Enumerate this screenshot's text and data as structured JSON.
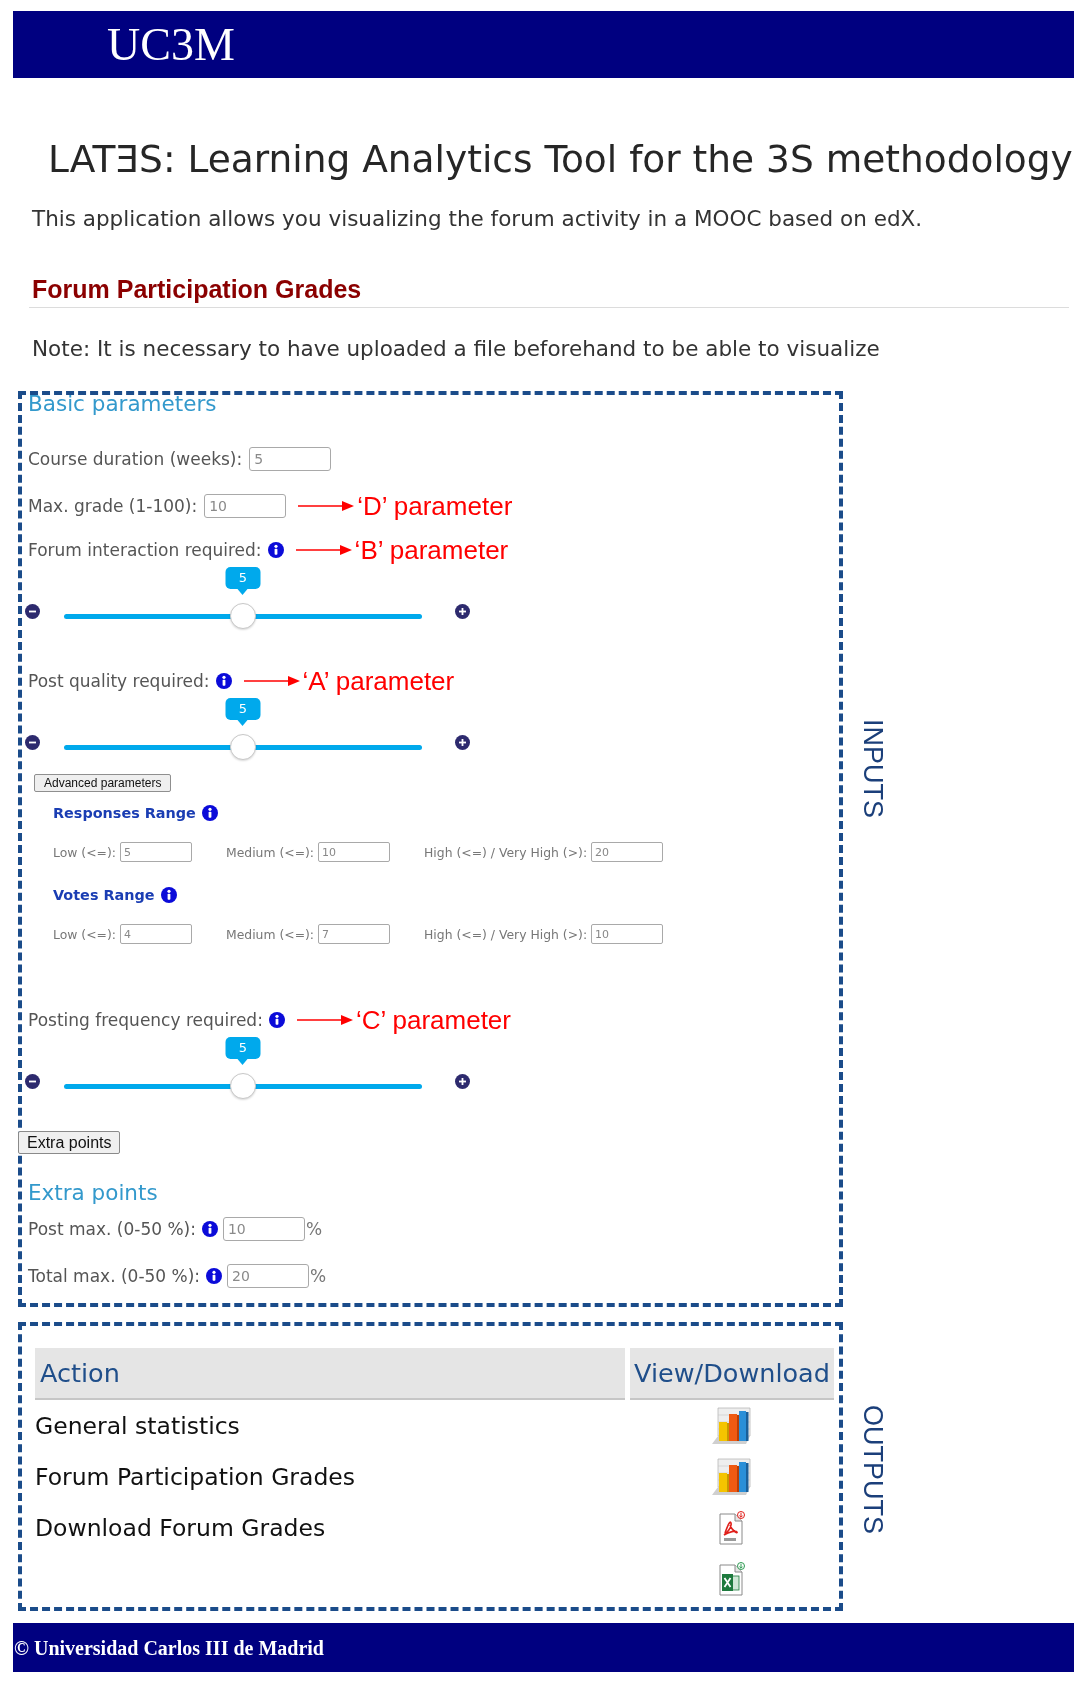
{
  "header": {
    "logo": "UC3M"
  },
  "title": "LATƎS: Learning Analytics Tool for the 3S methodology",
  "description": "This application allows you visualizing the forum activity in a MOOC based on edX.",
  "section": {
    "heading": "Forum Participation Grades",
    "note": "Note: It is necessary to have uploaded a file beforehand to be able to visualize"
  },
  "inputs": {
    "label": "INPUTS",
    "items": [
      {
        "kind": "heading",
        "text": "Basic parameters"
      },
      {
        "kind": "field",
        "label": "Course duration (weeks):",
        "info": false,
        "value": "5"
      },
      {
        "kind": "field",
        "label": "Max. grade (1-100):",
        "info": false,
        "value": "10",
        "annotation": "‘D’ parameter"
      },
      {
        "kind": "slider",
        "label": "Forum interaction required:",
        "info": true,
        "annotation": "‘B’ parameter",
        "value": "5",
        "level": 0.5
      },
      {
        "kind": "slider",
        "label": "Post quality required:",
        "info": true,
        "annotation": "‘A’ parameter",
        "value": "5",
        "level": 0.5
      },
      {
        "kind": "minibutton",
        "label": "Advanced parameters"
      },
      {
        "kind": "range",
        "heading": "Responses Range",
        "info": true,
        "fields": [
          {
            "label": "Low (<=):",
            "value": "5"
          },
          {
            "label": "Medium (<=):",
            "value": "10"
          },
          {
            "label": "High (<=) / Very High (>):",
            "value": "20"
          }
        ]
      },
      {
        "kind": "range",
        "heading": "Votes Range",
        "info": true,
        "fields": [
          {
            "label": "Low (<=):",
            "value": "4"
          },
          {
            "label": "Medium (<=):",
            "value": "7"
          },
          {
            "label": "High (<=) / Very High (>):",
            "value": "10"
          }
        ]
      },
      {
        "kind": "slider",
        "label": "Posting frequency required:",
        "info": true,
        "annotation": "‘C’ parameter",
        "value": "5",
        "level": 0.5
      },
      {
        "kind": "button",
        "label": "Extra points"
      },
      {
        "kind": "heading",
        "text": "Extra points"
      },
      {
        "kind": "field",
        "label": "Post max. (0-50 %):",
        "info": true,
        "value": "10",
        "unit": "%"
      },
      {
        "kind": "field",
        "label": "Total max. (0-50 %):",
        "info": true,
        "value": "20",
        "unit": "%"
      }
    ]
  },
  "outputs": {
    "label": "OUTPUTS",
    "columns": [
      "Action",
      "View/Download"
    ],
    "rows": [
      {
        "action": "General statistics",
        "kind": "chart"
      },
      {
        "action": "Forum Participation Grades",
        "kind": "chart"
      },
      {
        "action": "Download Forum Grades",
        "kind": "pdf"
      },
      {
        "kind": "spreadsheet"
      }
    ]
  },
  "footer": "© Universidad Carlos III de Madrid"
}
